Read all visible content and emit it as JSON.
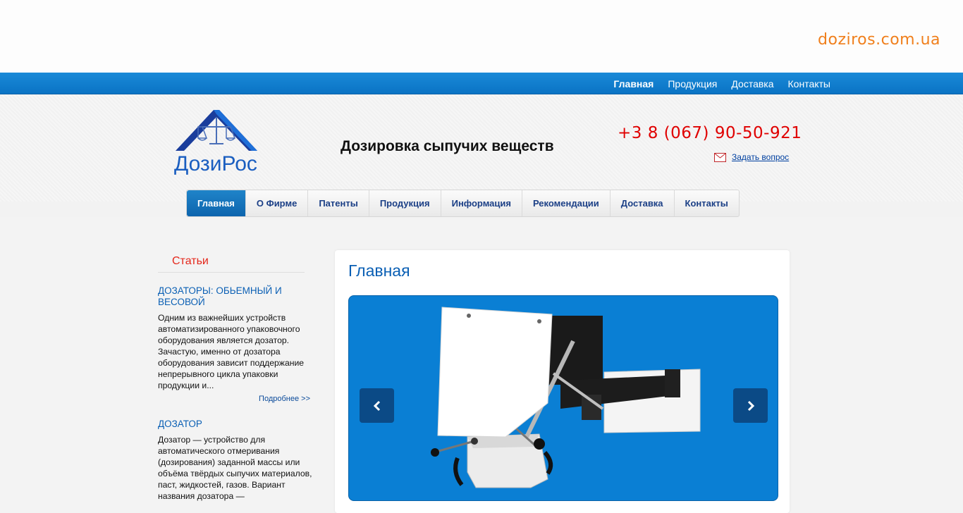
{
  "site": {
    "domain": "doziros.com.ua",
    "logo_text": "ДозиРос",
    "tagline": "Дозировка сыпучих веществ",
    "phone": "+3 8 (067) 90-50-921",
    "ask_link": "Задать вопрос"
  },
  "topnav": [
    {
      "label": "Главная",
      "active": true
    },
    {
      "label": "Продукция",
      "active": false
    },
    {
      "label": "Доставка",
      "active": false
    },
    {
      "label": "Контакты",
      "active": false
    }
  ],
  "mainnav": [
    {
      "label": "Главная",
      "active": true
    },
    {
      "label": "О Фирме",
      "active": false
    },
    {
      "label": "Патенты",
      "active": false
    },
    {
      "label": "Продукция",
      "active": false
    },
    {
      "label": "Информация",
      "active": false
    },
    {
      "label": "Рекомендации",
      "active": false
    },
    {
      "label": "Доставка",
      "active": false
    },
    {
      "label": "Контакты",
      "active": false
    }
  ],
  "sidebar": {
    "title": "Статьи",
    "articles": [
      {
        "title": "ДОЗАТОРЫ: ОБЬЕМНЫЙ И ВЕСОВОЙ",
        "text": "Одним из важнейших устройств автоматизированного упаковочного оборудования является дозатор. Зачастую, именно от дозатора оборудования зависит поддержание непрерывного цикла упаковки продукции и...",
        "more": "Подробнее >>"
      },
      {
        "title": "ДОЗАТОР",
        "text": "Дозатор — устройство для автоматического отмеривания (дозирования) заданной массы или объёма твёрдых сыпучих материалов, паст, жидкостей, газов. Вариант названия дозатора —"
      }
    ]
  },
  "content": {
    "heading": "Главная"
  },
  "colors": {
    "accent_blue": "#0a7fd4",
    "domain_orange": "#f07f1c",
    "phone_red": "#e00000"
  },
  "icons": [
    "mail-icon",
    "chevron-left-icon",
    "chevron-right-icon",
    "scales-logo-icon"
  ]
}
